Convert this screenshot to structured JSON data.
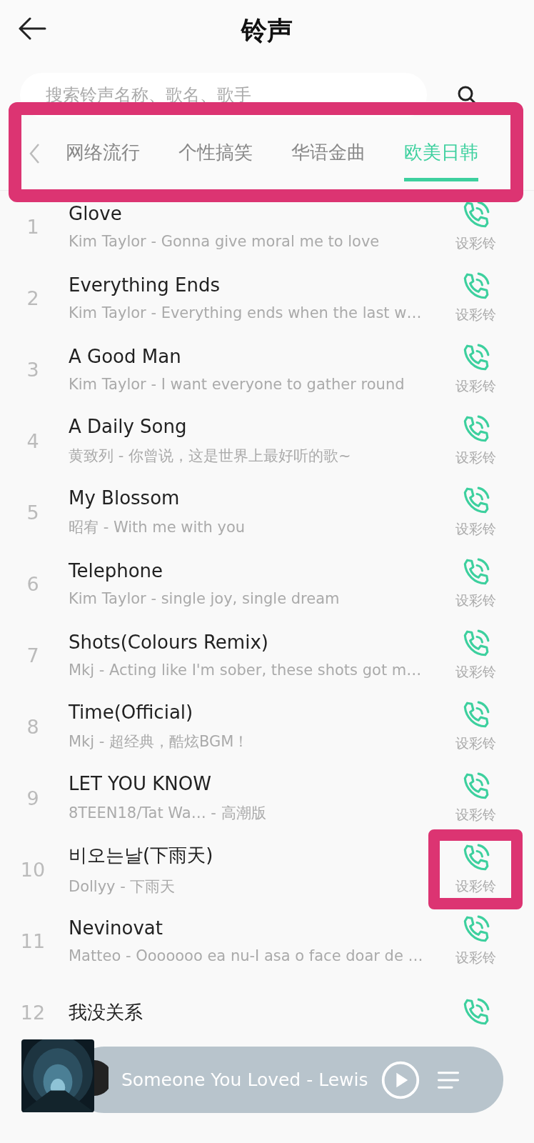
{
  "header": {
    "title": "铃声"
  },
  "search": {
    "placeholder": "搜索铃声名称、歌名、歌手"
  },
  "tabs": [
    {
      "label": "网络流行",
      "selected": false
    },
    {
      "label": "个性搞笑",
      "selected": false
    },
    {
      "label": "华语金曲",
      "selected": false
    },
    {
      "label": "欧美日韩",
      "selected": true
    }
  ],
  "songs": [
    {
      "number": "1",
      "title": "Glove",
      "subtitle": "Kim Taylor - Gonna give moral me to love",
      "action": "设彩铃",
      "highlighted": false
    },
    {
      "number": "2",
      "title": "Everything Ends",
      "subtitle": "Kim Taylor - Everything ends when the last w…",
      "action": "设彩铃",
      "highlighted": false
    },
    {
      "number": "3",
      "title": "A Good Man",
      "subtitle": "Kim Taylor - I want everyone to gather round",
      "action": "设彩铃",
      "highlighted": false
    },
    {
      "number": "4",
      "title": "A Daily Song",
      "subtitle": "黄致列 - 你曾说，这是世界上最好听的歌~",
      "action": "设彩铃",
      "highlighted": false
    },
    {
      "number": "5",
      "title": "My Blossom",
      "subtitle": "昭宥 - With me with you",
      "action": "设彩铃",
      "highlighted": false
    },
    {
      "number": "6",
      "title": "Telephone",
      "subtitle": "Kim Taylor - single joy, single dream",
      "action": "设彩铃",
      "highlighted": false
    },
    {
      "number": "7",
      "title": "Shots(Colours Remix)",
      "subtitle": "Mkj - Acting like I'm sober, these shots got m…",
      "action": "设彩铃",
      "highlighted": false
    },
    {
      "number": "8",
      "title": "Time(Official)",
      "subtitle": "Mkj - 超经典，酷炫BGM！",
      "action": "设彩铃",
      "highlighted": false
    },
    {
      "number": "9",
      "title": "LET YOU KNOW",
      "subtitle": "8TEEN18/Tat Wa… - 高潮版",
      "action": "设彩铃",
      "highlighted": false
    },
    {
      "number": "10",
      "title": "비오는날(下雨天)",
      "subtitle": "Dollyy - 下雨天",
      "action": "设彩铃",
      "highlighted": true
    },
    {
      "number": "11",
      "title": "Nevinovat",
      "subtitle": "Matteo - Ooooooo ea nu-I asa o face doar de …",
      "action": "设彩铃",
      "highlighted": false
    },
    {
      "number": "12",
      "title": "我没关系",
      "highlighted": false
    }
  ],
  "player": {
    "title": "Someone You Loved - Lewis"
  }
}
